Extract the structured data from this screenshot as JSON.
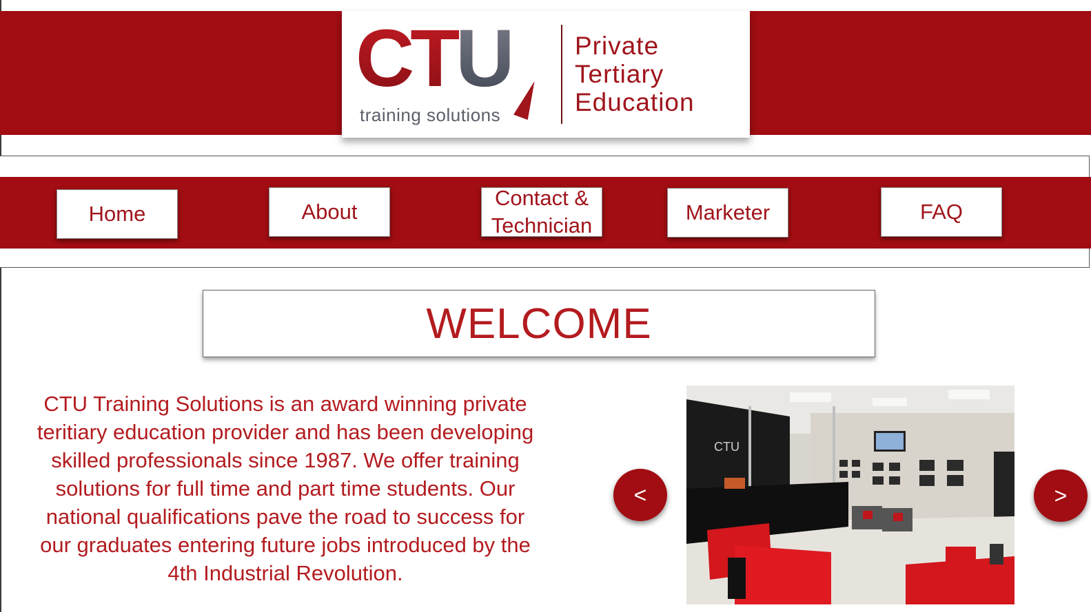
{
  "brand": {
    "logo_letters_ct": "CT",
    "logo_letter_u": "U",
    "logo_subtitle": "training solutions",
    "tagline": [
      "Private",
      "Tertiary",
      "Education"
    ],
    "colors": {
      "primary_red": "#a10d12",
      "text_red": "#b31b1f",
      "logo_gray": "#5a5f6a"
    }
  },
  "nav": {
    "items": [
      {
        "lines": [
          "Home"
        ]
      },
      {
        "lines": [
          "About"
        ]
      },
      {
        "lines": [
          "Contact &",
          "Technician"
        ]
      },
      {
        "lines": [
          "Marketer"
        ]
      },
      {
        "lines": [
          "FAQ"
        ]
      }
    ]
  },
  "welcome": {
    "title": "WELCOME"
  },
  "intro": {
    "lines": [
      "CTU Training Solutions is an award winning private",
      "teritiary education provider and has been developing",
      "skilled professionals since 1987. We offer training",
      "solutions for full time and part time students. Our",
      "national qualifications pave the road to success for",
      "our graduates entering future jobs introduced by the",
      "4th Industrial Revolution."
    ]
  },
  "carousel": {
    "prev_label": "<",
    "next_label": ">",
    "image_sign": "CTU"
  }
}
